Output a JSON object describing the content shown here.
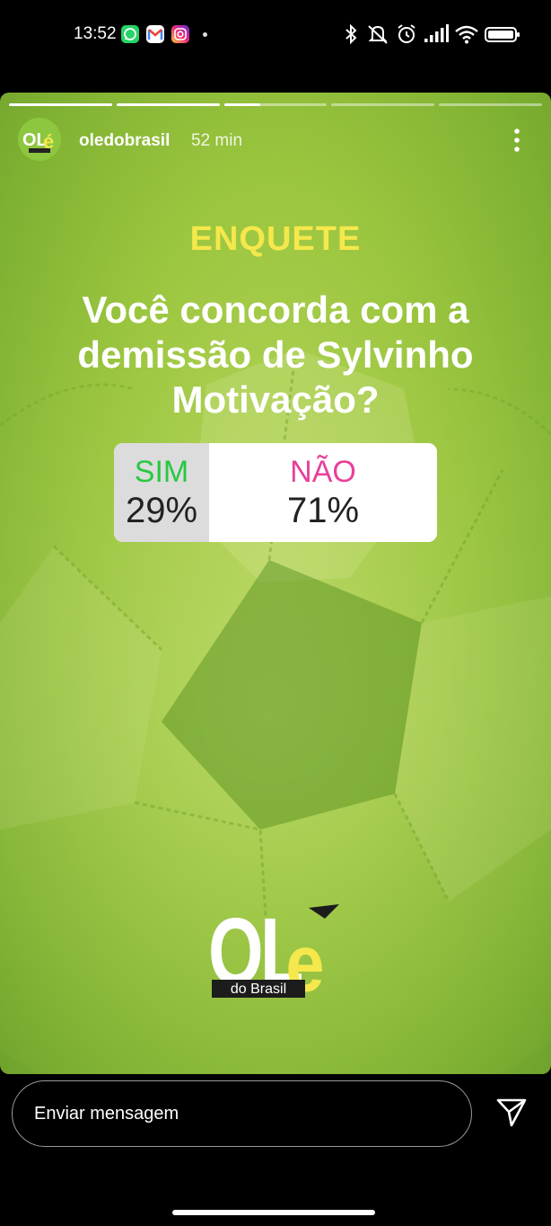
{
  "status_bar": {
    "time": "13:52",
    "left_icons": [
      "whatsapp-icon",
      "gmail-icon",
      "instagram-icon"
    ],
    "right_icons": [
      "bluetooth-icon",
      "mute-icon",
      "alarm-icon",
      "signal-icon",
      "wifi-icon",
      "battery-icon"
    ]
  },
  "story": {
    "progress_segments": [
      1,
      1,
      0.35,
      0,
      0
    ],
    "username": "oledobrasil",
    "time_ago": "52 min",
    "menu_icon": "more-vertical-icon",
    "title": "ENQUETE",
    "question": "Você concorda com a demissão de Sylvinho Motivação?",
    "poll": {
      "options": [
        {
          "label": "SIM",
          "percent": "29%",
          "color": "#28c840"
        },
        {
          "label": "NÃO",
          "percent": "71%",
          "color": "#e8409a"
        }
      ]
    },
    "logo": {
      "main": "OLé",
      "sub": "do Brasil"
    },
    "background_color": "#9cc63f",
    "title_color": "#f5e84c"
  },
  "bottom_bar": {
    "message_placeholder": "Enviar mensagem",
    "send_icon": "send-icon"
  }
}
